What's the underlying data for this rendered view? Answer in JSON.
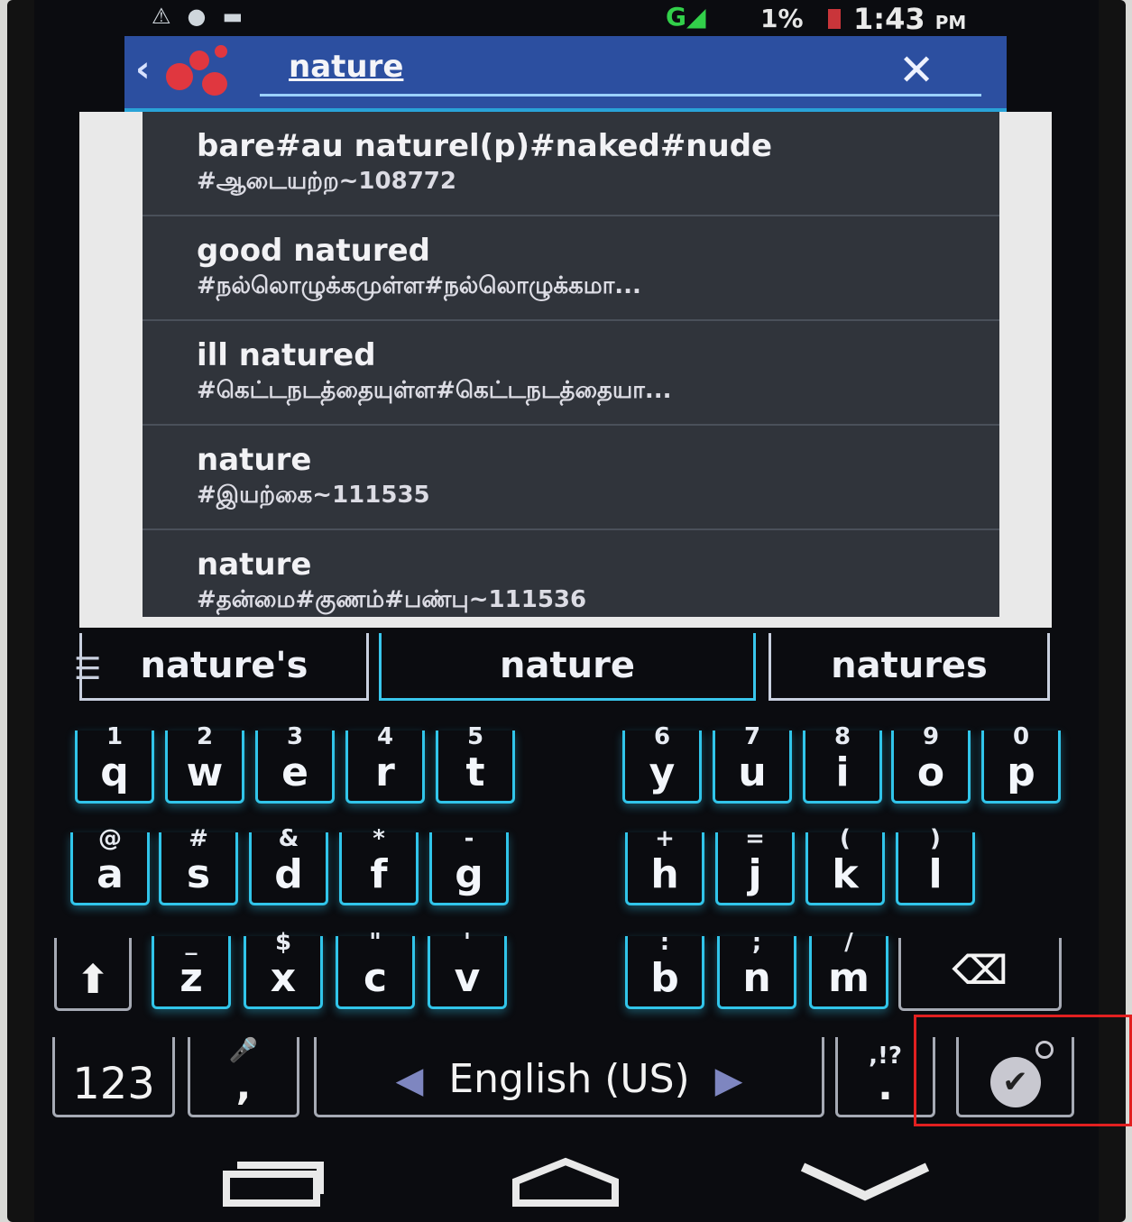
{
  "status": {
    "network": "G",
    "battery": "1%",
    "time": "1:43",
    "ampm": "PM"
  },
  "search": {
    "query": "nature"
  },
  "suggestions_list": [
    {
      "en": "bare#au naturel(p)#naked#nude",
      "ta": "#ஆடையற்ற~108772"
    },
    {
      "en": "good natured",
      "ta": "#நல்லொழுக்கமுள்ள#நல்லொழுக்கமா..."
    },
    {
      "en": "ill natured",
      "ta": "#கெட்டநடத்தையுள்ள#கெட்டநடத்தையா..."
    },
    {
      "en": "nature",
      "ta": "#இயற்கை~111535"
    },
    {
      "en": "nature",
      "ta": "#தன்மை#குணம்#பண்பு~111536"
    }
  ],
  "strip": {
    "left": "nature's",
    "middle": "nature",
    "right": "natures"
  },
  "keyboard": {
    "row1": [
      [
        "q",
        "1"
      ],
      [
        "w",
        "2"
      ],
      [
        "e",
        "3"
      ],
      [
        "r",
        "4"
      ],
      [
        "t",
        "5"
      ],
      [
        "y",
        "6"
      ],
      [
        "u",
        "7"
      ],
      [
        "i",
        "8"
      ],
      [
        "o",
        "9"
      ],
      [
        "p",
        "0"
      ]
    ],
    "row2": [
      [
        "a",
        "@"
      ],
      [
        "s",
        "#"
      ],
      [
        "d",
        "&"
      ],
      [
        "f",
        "*"
      ],
      [
        "g",
        "-"
      ],
      [
        "h",
        "+"
      ],
      [
        "j",
        "="
      ],
      [
        "k",
        "("
      ],
      [
        "l",
        ")"
      ]
    ],
    "row3": [
      [
        "z",
        "_"
      ],
      [
        "x",
        "$"
      ],
      [
        "c",
        "\""
      ],
      [
        "v",
        "'"
      ],
      [
        "b",
        ":"
      ],
      [
        "n",
        ";"
      ],
      [
        "m",
        "/"
      ]
    ],
    "numbers_key": "123",
    "comma_key": ",",
    "space_label": "English (US)",
    "period_key": ".",
    "period_alt": ",!?"
  }
}
